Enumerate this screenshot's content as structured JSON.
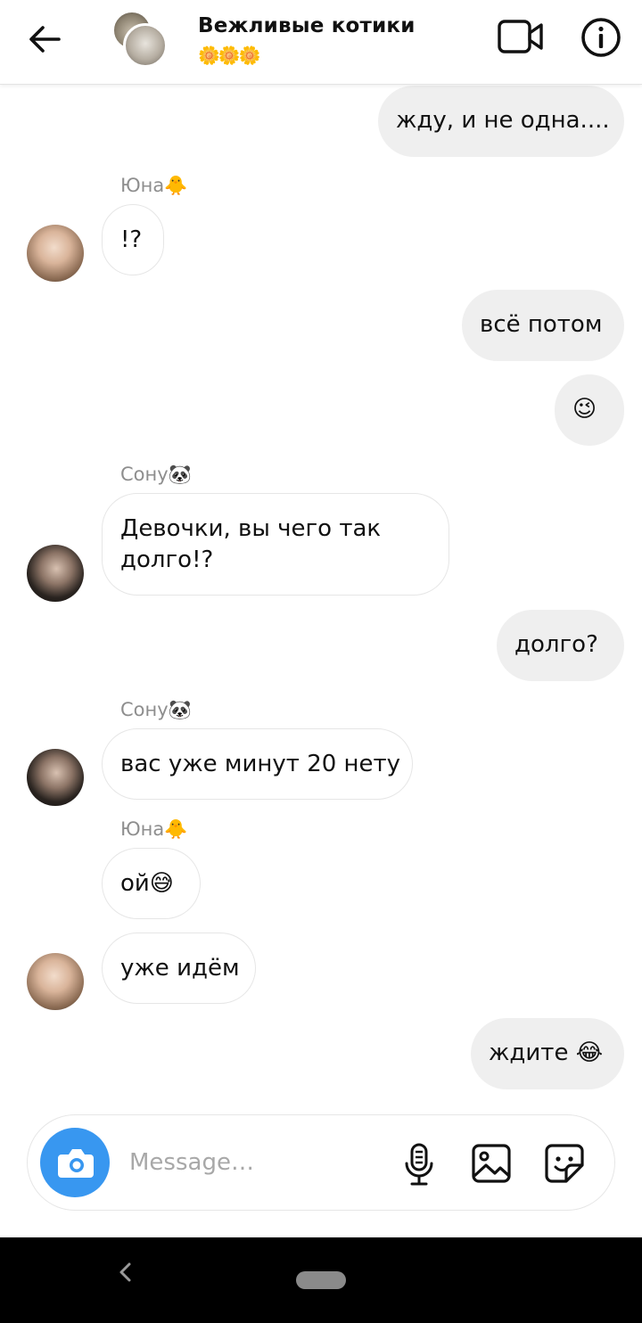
{
  "header": {
    "title": "Вежливые котики",
    "subtitle": "🌼🌼🌼"
  },
  "messages": [
    {
      "direction": "out",
      "text": "жду, и не одна...."
    },
    {
      "direction": "in",
      "sender": "Юна🐥",
      "text": "!?"
    },
    {
      "direction": "out",
      "text": "всё потом"
    },
    {
      "direction": "out",
      "text": "😉"
    },
    {
      "direction": "in",
      "sender": "Сону🐼",
      "text_lines": [
        "Девочки, вы чего так",
        "долго!?"
      ]
    },
    {
      "direction": "out",
      "text": "долго?"
    },
    {
      "direction": "in",
      "sender": "Сону🐼",
      "text": "вас уже минут 20 нету"
    },
    {
      "direction": "in",
      "sender": "Юна🐥",
      "text": "ой😅"
    },
    {
      "direction": "in",
      "text": "уже идём"
    },
    {
      "direction": "out",
      "text": "ждите 😂"
    }
  ],
  "composer": {
    "placeholder": "Message…"
  },
  "colors": {
    "accent": "#3897f0",
    "outgoing_bubble": "#efefef",
    "incoming_border": "#e6e6e6"
  },
  "icons": [
    "back-arrow-icon",
    "video-call-icon",
    "info-icon",
    "camera-icon",
    "microphone-icon",
    "gallery-icon",
    "sticker-icon",
    "nav-back-icon"
  ]
}
